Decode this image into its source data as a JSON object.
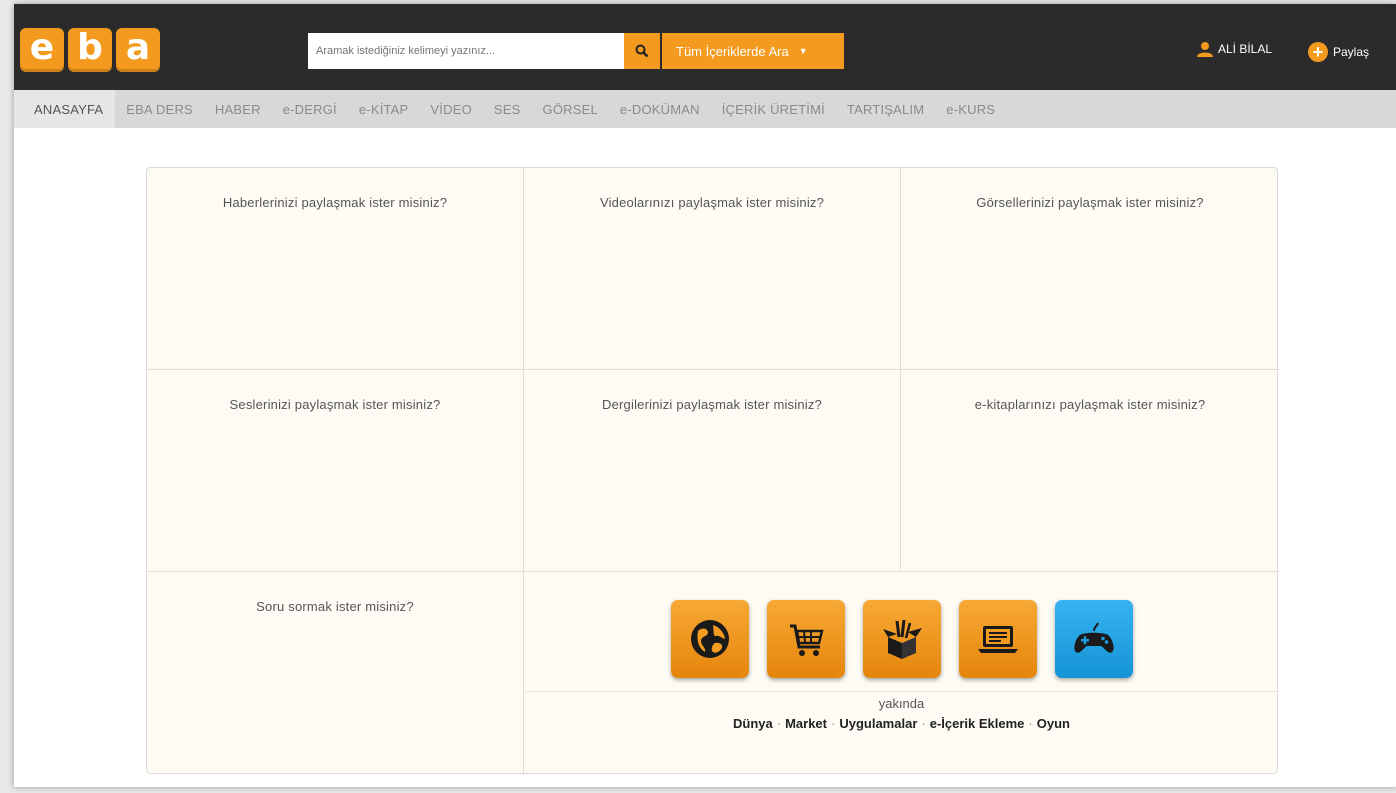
{
  "logo": {
    "letters": [
      "e",
      "b",
      "a"
    ]
  },
  "search": {
    "placeholder": "Aramak istediğiniz kelimeyi yazınız...",
    "scope_label": "Tüm İçeriklerde Ara"
  },
  "user": {
    "name": "ALİ BİLAL",
    "share_label": "Paylaş"
  },
  "nav": {
    "items": [
      "ANASAYFA",
      "EBA DERS",
      "HABER",
      "e-DERGİ",
      "e-KİTAP",
      "VİDEO",
      "SES",
      "GÖRSEL",
      "e-DOKÜMAN",
      "İÇERİK ÜRETİMİ",
      "TARTIŞALIM",
      "e-KURS"
    ]
  },
  "cells": [
    "Haberlerinizi paylaşmak ister misiniz?",
    "Videolarınızı paylaşmak ister misiniz?",
    "Görsellerinizi paylaşmak ister misiniz?",
    "Seslerinizi paylaşmak ister misiniz?",
    "Dergilerinizi paylaşmak ister misiniz?",
    "e-kitaplarınızı paylaşmak ister misiniz?",
    "Soru sormak ister misiniz?"
  ],
  "apps": {
    "soon_label": "yakında",
    "icons": [
      "globe-icon",
      "cart-icon",
      "box-icon",
      "laptop-icon",
      "gamepad-icon"
    ],
    "links": [
      "Dünya",
      "Market",
      "Uygulamalar",
      "e-İçerik Ekleme",
      "Oyun"
    ]
  },
  "colors": {
    "accent": "#f39a1f",
    "topbar": "#2b2b2b",
    "game": "#1e9ee2"
  }
}
